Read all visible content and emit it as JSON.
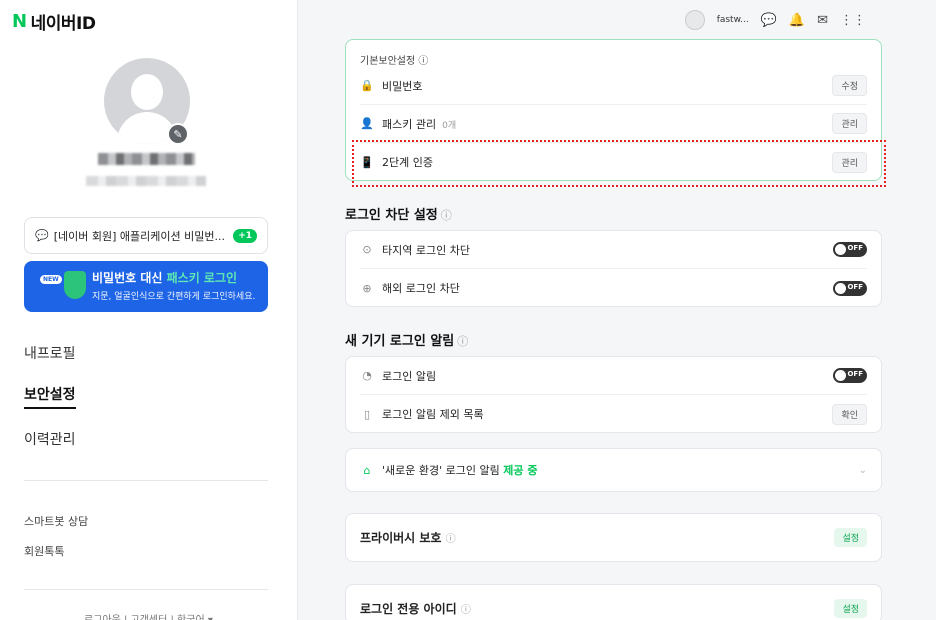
{
  "sidebar": {
    "logo_n": "N",
    "logo_text": "네이버ID",
    "notice_text": "[네이버 회원] 애플리케이션 비밀번...",
    "notice_badge": "+1",
    "banner": {
      "badge": "NEW",
      "title_prefix": "비밀번호 대신",
      "title_highlight": "패스키 로그인",
      "subtitle": "지문, 얼굴인식으로 간편하게 로그인하세요."
    },
    "nav": [
      "내프로필",
      "보안설정",
      "이력관리"
    ],
    "links": [
      "스마트봇 상담",
      "회원톡톡"
    ],
    "footer": "로그아웃 | 고객센터 | 한국어 ▾"
  },
  "topbar": {
    "username": "fastw..."
  },
  "basic_security": {
    "caption": "기본보안설정",
    "password": {
      "label": "비밀번호",
      "action": "수정"
    },
    "passkey": {
      "label": "패스키 관리",
      "count": "0개",
      "action": "관리"
    },
    "two_step": {
      "label": "2단계 인증",
      "action": "관리"
    }
  },
  "login_block": {
    "title": "로그인 차단 설정",
    "rows": [
      {
        "label": "타지역 로그인 차단",
        "state": "OFF"
      },
      {
        "label": "해외 로그인 차단",
        "state": "OFF"
      }
    ]
  },
  "new_device": {
    "title": "새 기기 로그인 알림",
    "alert": {
      "label": "로그인 알림",
      "state": "OFF"
    },
    "exclude": {
      "label": "로그인 알림 제외 목록",
      "action": "확인"
    }
  },
  "new_env": {
    "label": "'새로운 환경' 로그인 알림",
    "status": "제공 중"
  },
  "privacy": {
    "label": "프라이버시 보호",
    "action": "설정"
  },
  "login_only_id": {
    "label": "로그인 전용 아이디",
    "action": "설정"
  },
  "colors": {
    "brand": "#03c75a",
    "banner": "#1e64e6",
    "highlight": "#e52020"
  }
}
